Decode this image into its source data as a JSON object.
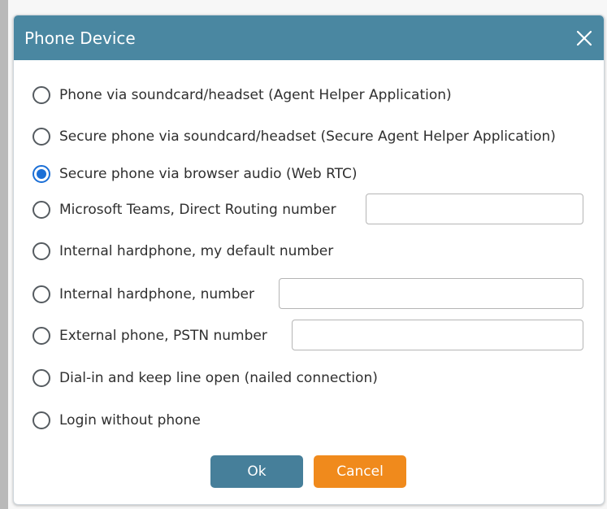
{
  "dialog": {
    "title": "Phone Device",
    "close_icon": "close-icon"
  },
  "options": [
    {
      "label": "Phone via soundcard/headset (Agent Helper Application)",
      "selected": false
    },
    {
      "label": "Secure phone via soundcard/headset (Secure Agent Helper Application)",
      "selected": false
    },
    {
      "label": "Secure phone via browser audio (Web RTC)",
      "selected": true
    },
    {
      "label": "Microsoft Teams, Direct Routing number",
      "selected": false,
      "field_value": "",
      "field_placeholder": ""
    },
    {
      "label": "Internal hardphone, my default number",
      "selected": false
    },
    {
      "label": "Internal hardphone, number",
      "selected": false,
      "field_value": "",
      "field_placeholder": ""
    },
    {
      "label": "External phone, PSTN number",
      "selected": false,
      "field_value": "",
      "field_placeholder": ""
    },
    {
      "label": "Dial-in and keep line open (nailed connection)",
      "selected": false
    },
    {
      "label": "Login without phone",
      "selected": false
    }
  ],
  "buttons": {
    "ok_label": "Ok",
    "cancel_label": "Cancel"
  },
  "colors": {
    "titlebar": "#4a87a1",
    "ok_button": "#467f9a",
    "cancel_button": "#f08a1c",
    "radio_selected": "#1b6fd6"
  }
}
